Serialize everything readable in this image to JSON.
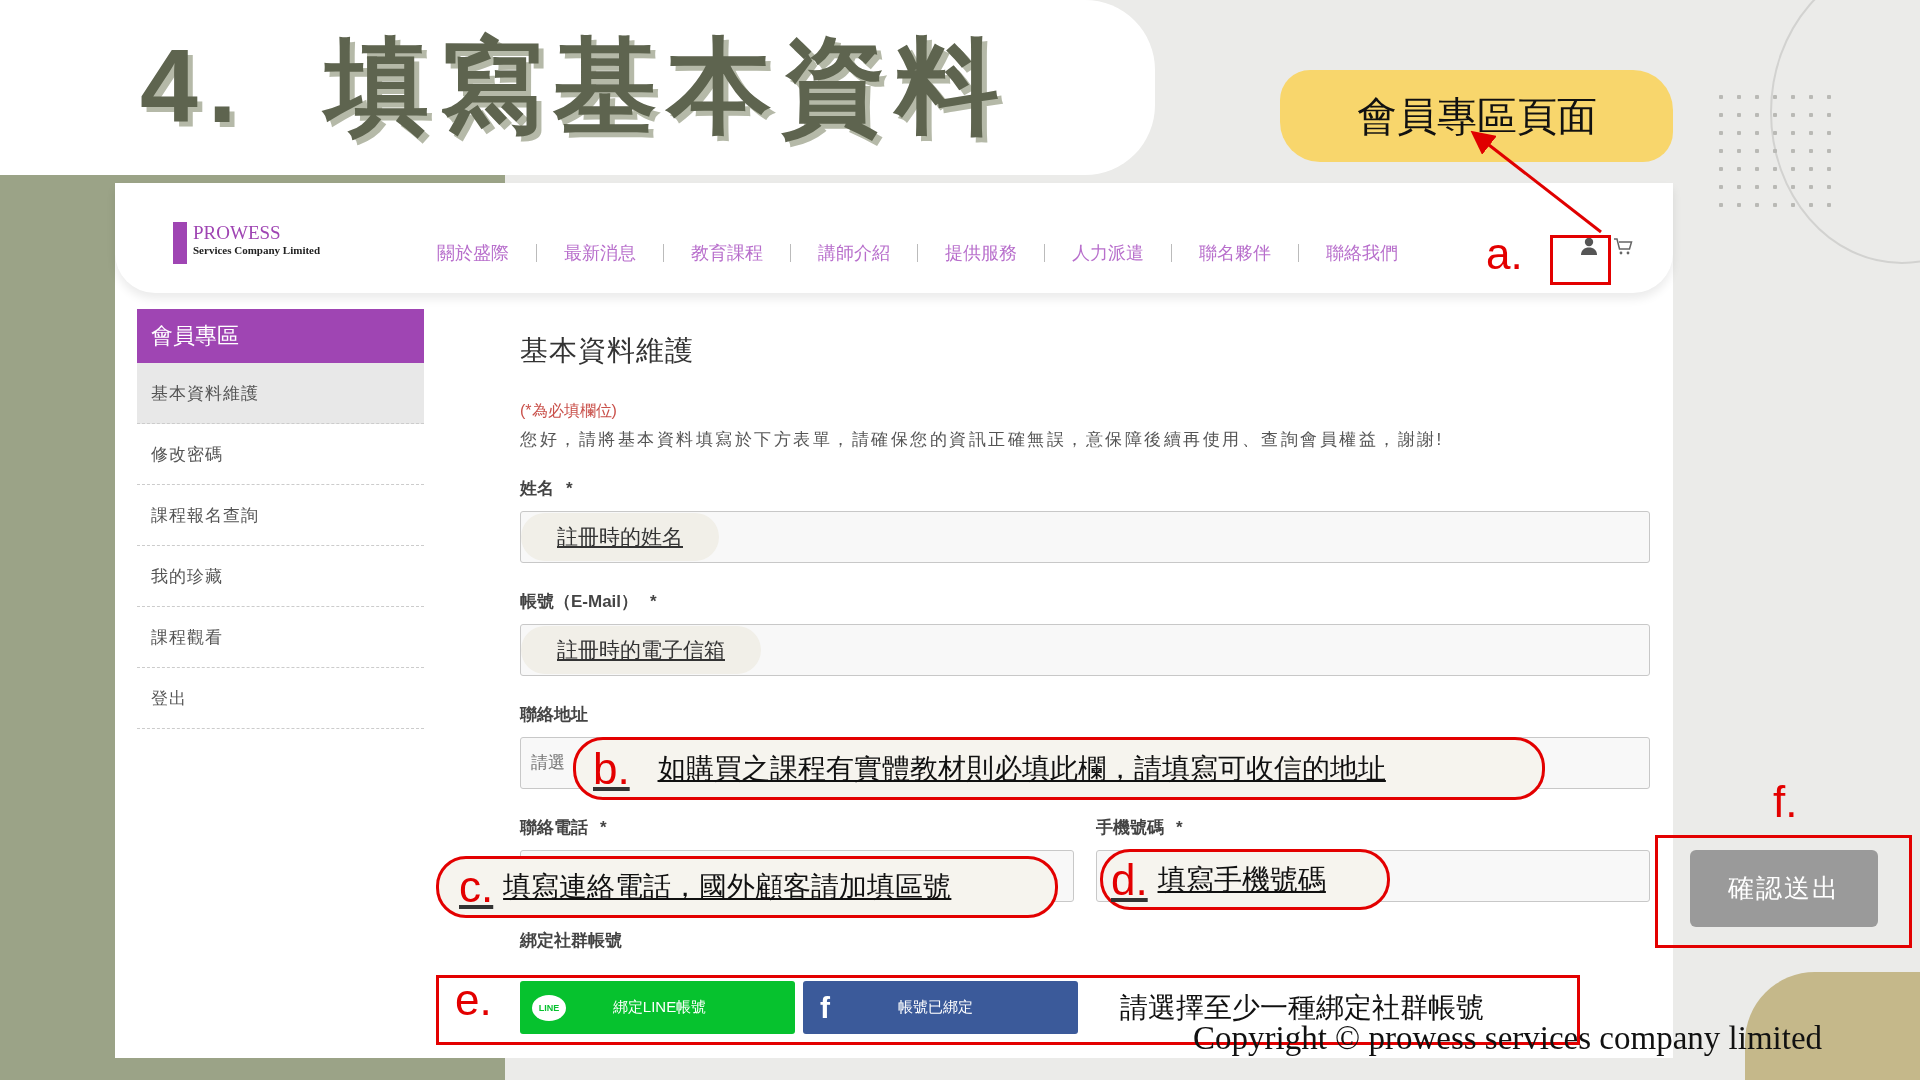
{
  "slide_title": "4.  填寫基本資料",
  "callout": "會員專區頁面",
  "site": {
    "logo": {
      "name": "PROWESS",
      "tagline": "Services Company Limited"
    },
    "nav": [
      "關於盛際",
      "最新消息",
      "教育課程",
      "講師介紹",
      "提供服務",
      "人力派遣",
      "聯名夥伴",
      "聯絡我們"
    ]
  },
  "sidebar": {
    "title": "會員專區",
    "items": [
      {
        "label": "基本資料維護",
        "selected": true
      },
      {
        "label": "修改密碼",
        "selected": false
      },
      {
        "label": "課程報名查詢",
        "selected": false
      },
      {
        "label": "我的珍藏",
        "selected": false
      },
      {
        "label": "課程觀看",
        "selected": false
      },
      {
        "label": "登出",
        "selected": false
      }
    ]
  },
  "form": {
    "title": "基本資料維護",
    "required_note": "(*為必填欄位)",
    "intro": "您好，請將基本資料填寫於下方表單，請確保您的資訊正確無誤，意保障後續再使用、查詢會員權益，謝謝!",
    "fields": [
      {
        "label": "姓名",
        "required_mark": "*",
        "value": "註冊時的姓名"
      },
      {
        "label": "帳號（E-Mail）",
        "required_mark": "*",
        "value": "註冊時的電子信箱"
      },
      {
        "label": "聯絡地址",
        "placeholder": "請選"
      }
    ],
    "phone_fields": [
      {
        "label": "聯絡電話",
        "required_mark": "*"
      },
      {
        "label": "手機號碼",
        "required_mark": "*"
      }
    ],
    "social_label": "綁定社群帳號",
    "social_buttons": [
      {
        "kind": "line",
        "icon_text": "LINE",
        "label": "綁定LINE帳號"
      },
      {
        "kind": "facebook",
        "icon_text": "f",
        "label": "帳號已綁定"
      }
    ],
    "submit": {
      "label": "確認送出",
      "disabled": true
    }
  },
  "annotations": [
    {
      "letter": "a."
    },
    {
      "letter": "b.",
      "text": "如購買之課程有實體教材則必填此欄，請填寫可收信的地址"
    },
    {
      "letter": "c.",
      "text": "填寫連絡電話，國外顧客請加填區號"
    },
    {
      "letter": "d.",
      "text": "填寫手機號碼"
    },
    {
      "letter": "e.",
      "text": "請選擇至少一種綁定社群帳號"
    },
    {
      "letter": "f."
    }
  ],
  "copyright": "Copyright © prowess services company limited"
}
